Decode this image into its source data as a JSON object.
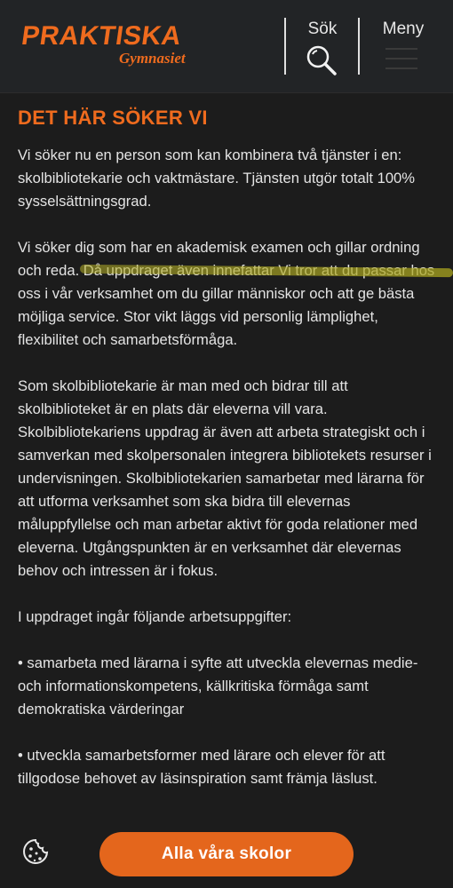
{
  "header": {
    "logo_main": "PRAKTISKA",
    "logo_sub": "Gymnasiet",
    "search_label": "Sök",
    "menu_label": "Meny"
  },
  "content": {
    "heading": "DET HÄR SÖKER VI",
    "paragraphs": [
      "Vi söker nu en person som kan kombinera två tjänster i en: skolbibliotekarie och vaktmästare. Tjänsten utgör totalt 100% sysselsättningsgrad.",
      "Vi söker dig som har en akademisk examen och gillar ordning och reda. Då uppdraget även innefattar Vi tror att du passar hos oss i vår verksamhet om du gillar människor och att ge bästa möjliga service.   Stor vikt läggs vid personlig lämplighet, flexibilitet och samarbetsförmåga.",
      "Som skolbibliotekarie är man med och bidrar till att skolbiblioteket är en plats där eleverna vill vara. Skolbibliotekariens uppdrag är även att arbeta strategiskt och i samverkan med skolpersonalen integrera bibliotekets resurser i undervisningen. Skolbibliotekarien samarbetar med lärarna för att utforma verksamhet som ska bidra till elevernas måluppfyllelse och man arbetar aktivt för goda relationer med eleverna. Utgångspunkten är en verksamhet där elevernas behov och intressen är i fokus.",
      "I uppdraget ingår följande arbetsuppgifter:",
      "• samarbeta med lärarna i syfte att utveckla elevernas medie- och informationskompetens, källkritiska förmåga samt demokratiska värderingar",
      "• utveckla samarbetsformer med lärare och elever för att tillgodose behovet av läsinspiration samt främja läslust."
    ]
  },
  "footer": {
    "schools_button": "Alla våra skolor",
    "cookie_icon": "cookie-icon"
  },
  "colors": {
    "accent": "#ef6b1e",
    "background": "#1c1c1c",
    "header": "#222426",
    "highlight": "#b4af28"
  }
}
